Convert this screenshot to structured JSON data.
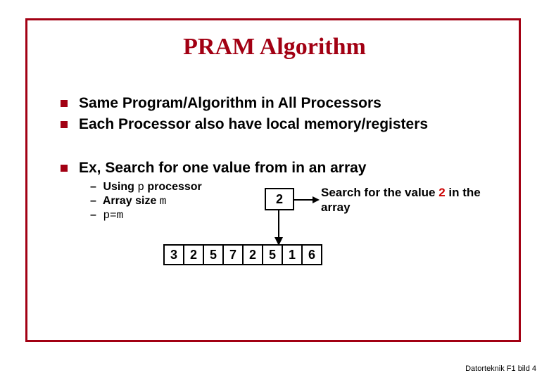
{
  "title": "PRAM Algorithm",
  "bullets": [
    "Same Program/Algorithm in All Processors",
    "Each Processor also have local memory/registers",
    "Ex, Search for one value from in an array"
  ],
  "sub": {
    "line1_pre": "Using ",
    "line1_mono": "p",
    "line1_post": " processor",
    "line2_pre": "Array size ",
    "line2_mono": "m",
    "line3_mono": "p=m"
  },
  "diagram": {
    "search_value": "2",
    "caption_pre": "Search for the value ",
    "caption_red": "2",
    "caption_post": " in the array",
    "array": [
      "3",
      "2",
      "5",
      "7",
      "2",
      "5",
      "1",
      "6"
    ]
  },
  "footer": "Datorteknik F1 bild 4"
}
